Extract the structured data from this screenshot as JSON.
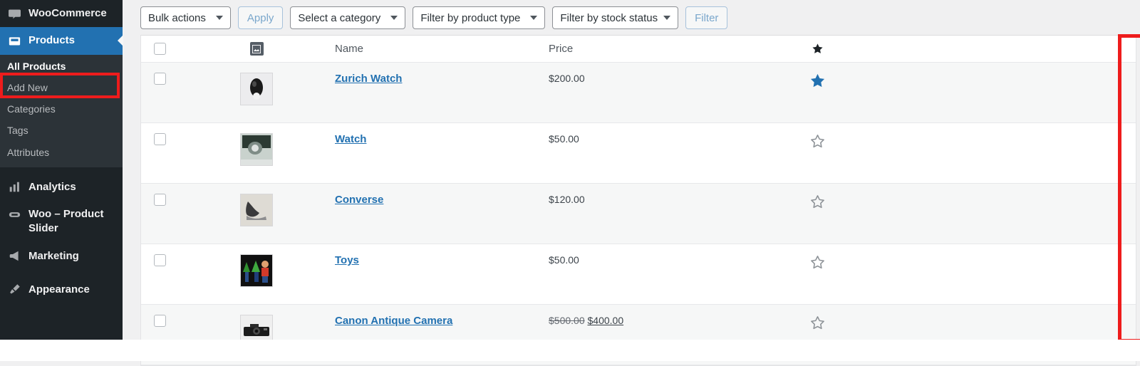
{
  "sidebar": {
    "items": [
      {
        "label": "WooCommerce",
        "icon": "woocommerce-icon",
        "active": false
      },
      {
        "label": "Products",
        "icon": "products-icon",
        "active": true
      },
      {
        "label": "Analytics",
        "icon": "analytics-icon",
        "active": false
      },
      {
        "label": "Woo – Product Slider",
        "icon": "slider-icon",
        "active": false
      },
      {
        "label": "Marketing",
        "icon": "marketing-icon",
        "active": false
      },
      {
        "label": "Appearance",
        "icon": "appearance-icon",
        "active": false
      }
    ],
    "submenu": [
      {
        "label": "All Products",
        "current": true
      },
      {
        "label": "Add New",
        "current": false
      },
      {
        "label": "Categories",
        "current": false
      },
      {
        "label": "Tags",
        "current": false
      },
      {
        "label": "Attributes",
        "current": false
      }
    ],
    "active_color": "#2271b1",
    "background": "#1d2327"
  },
  "highlight": {
    "color": "#ee1c1c",
    "targets": [
      "all-products-menu-item",
      "featured-star-column"
    ]
  },
  "toolbar": {
    "bulk_actions": "Bulk actions",
    "apply": "Apply",
    "select_category": "Select a category",
    "filter_product_type": "Filter by product type",
    "filter_stock_status": "Filter by stock status",
    "filter": "Filter"
  },
  "table": {
    "columns": {
      "checkbox": "",
      "image": "image-icon",
      "name": "Name",
      "price": "Price",
      "featured": "star-icon"
    },
    "rows": [
      {
        "name": "Zurich Watch",
        "price": "$200.00",
        "price_regular": "",
        "price_sale": "",
        "featured": true,
        "thumb": "watch-face-thumbnail",
        "checked": false
      },
      {
        "name": "Watch",
        "price": "$50.00",
        "price_regular": "",
        "price_sale": "",
        "featured": false,
        "thumb": "watch-thumbnail",
        "checked": false
      },
      {
        "name": "Converse",
        "price": "$120.00",
        "price_regular": "",
        "price_sale": "",
        "featured": false,
        "thumb": "shoe-thumbnail",
        "checked": false
      },
      {
        "name": "Toys",
        "price": "$50.00",
        "price_regular": "",
        "price_sale": "",
        "featured": false,
        "thumb": "toys-thumbnail",
        "checked": false
      },
      {
        "name": "Canon Antique Camera",
        "price": "",
        "price_regular": "$500.00",
        "price_sale": "$400.00",
        "featured": false,
        "thumb": "camera-thumbnail",
        "checked": false
      }
    ]
  },
  "colors": {
    "link": "#2271b1",
    "featured_star": "#2271b1",
    "empty_star": "#8c9196",
    "row_alt": "#f6f7f7"
  }
}
